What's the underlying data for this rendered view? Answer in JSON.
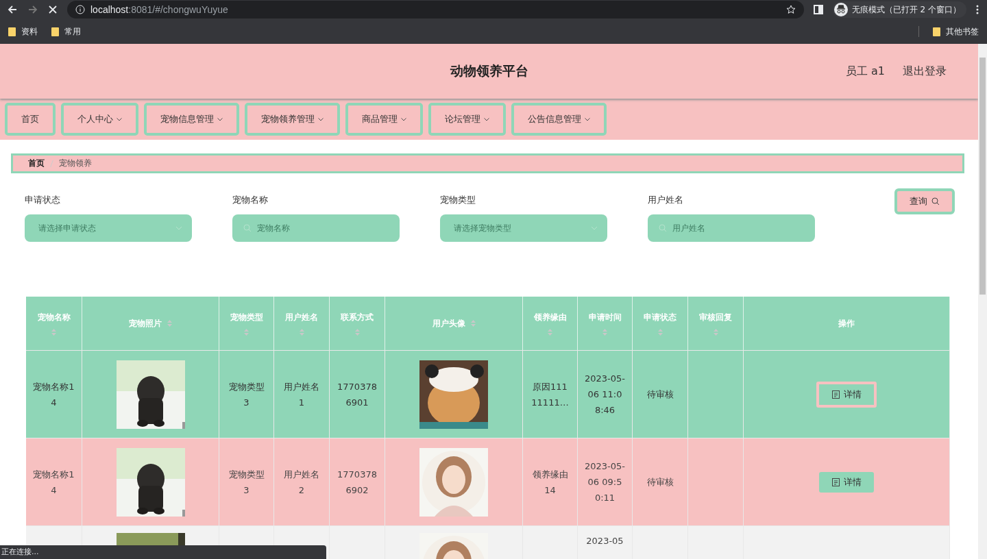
{
  "browser": {
    "url_host": "localhost",
    "url_rest": ":8081/#/chongwuYuyue",
    "incognito": "无痕模式（已打开 2 个窗口）",
    "bookmarks": [
      "资料",
      "常用"
    ],
    "other_bookmarks": "其他书签",
    "status": "正在连接..."
  },
  "header": {
    "title": "动物领养平台",
    "user": "员工 a1",
    "logout": "退出登录"
  },
  "nav": [
    {
      "label": "首页",
      "dropdown": false
    },
    {
      "label": "个人中心",
      "dropdown": true
    },
    {
      "label": "宠物信息管理",
      "dropdown": true
    },
    {
      "label": "宠物领养管理",
      "dropdown": true
    },
    {
      "label": "商品管理",
      "dropdown": true
    },
    {
      "label": "论坛管理",
      "dropdown": true
    },
    {
      "label": "公告信息管理",
      "dropdown": true
    }
  ],
  "breadcrumb": [
    "首页",
    "宠物领养"
  ],
  "filters": [
    {
      "label": "申请状态",
      "kind": "select",
      "placeholder": "请选择申请状态"
    },
    {
      "label": "宠物名称",
      "kind": "search",
      "placeholder": "宠物名称"
    },
    {
      "label": "宠物类型",
      "kind": "select",
      "placeholder": "请选择宠物类型"
    },
    {
      "label": "用户姓名",
      "kind": "search",
      "placeholder": "用户姓名"
    }
  ],
  "query_button": "查询",
  "table": {
    "columns": [
      {
        "label": "宠物名称",
        "sortable": true
      },
      {
        "label": "宠物照片",
        "sortable": true
      },
      {
        "label": "宠物类型",
        "sortable": true
      },
      {
        "label": "用户姓名",
        "sortable": true
      },
      {
        "label": "联系方式",
        "sortable": true
      },
      {
        "label": "用户头像",
        "sortable": true
      },
      {
        "label": "领养缘由",
        "sortable": true
      },
      {
        "label": "申请时间",
        "sortable": true
      },
      {
        "label": "申请状态",
        "sortable": true
      },
      {
        "label": "审核回复",
        "sortable": true
      },
      {
        "label": "操作",
        "sortable": false
      }
    ],
    "rows": [
      {
        "hovered": true,
        "pet_name": "宠物名称14",
        "pet_type": "宠物类型3",
        "user_name": "用户姓名1",
        "phone": "17703786901",
        "reason": "原因11111111…",
        "time": "2023-05-06 11:08:46",
        "status": "待审核",
        "reply": "",
        "action": "详情"
      },
      {
        "hovered": false,
        "pet_name": "宠物名称14",
        "pet_type": "宠物类型3",
        "user_name": "用户姓名2",
        "phone": "17703786902",
        "reason": "领养缘由14",
        "time": "2023-05-06 09:50:11",
        "status": "待审核",
        "reply": "",
        "action": "详情"
      },
      {
        "hovered": false,
        "time": "2023-05"
      }
    ]
  }
}
